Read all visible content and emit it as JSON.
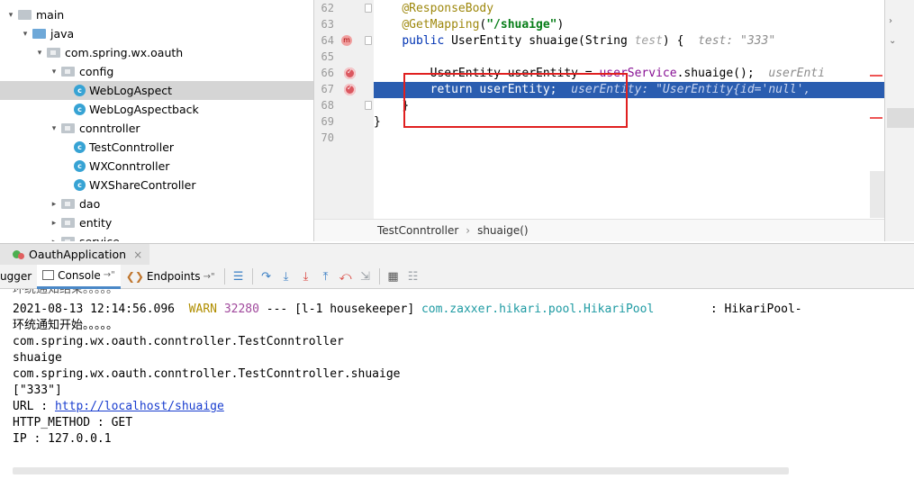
{
  "tree": {
    "items": [
      {
        "label": "main",
        "depth": 0,
        "arrow": "down",
        "icon": "folder"
      },
      {
        "label": "java",
        "depth": 1,
        "arrow": "down",
        "icon": "source-folder"
      },
      {
        "label": "com.spring.wx.oauth",
        "depth": 2,
        "arrow": "down",
        "icon": "package"
      },
      {
        "label": "config",
        "depth": 3,
        "arrow": "down",
        "icon": "package"
      },
      {
        "label": "WebLogAspect",
        "depth": 4,
        "arrow": "",
        "icon": "class",
        "selected": true
      },
      {
        "label": "WebLogAspectback",
        "depth": 4,
        "arrow": "",
        "icon": "class"
      },
      {
        "label": "conntroller",
        "depth": 3,
        "arrow": "down",
        "icon": "package"
      },
      {
        "label": "TestConntroller",
        "depth": 4,
        "arrow": "",
        "icon": "class"
      },
      {
        "label": "WXConntroller",
        "depth": 4,
        "arrow": "",
        "icon": "class"
      },
      {
        "label": "WXShareController",
        "depth": 4,
        "arrow": "",
        "icon": "class"
      },
      {
        "label": "dao",
        "depth": 3,
        "arrow": "right",
        "icon": "package"
      },
      {
        "label": "entity",
        "depth": 3,
        "arrow": "right",
        "icon": "package"
      },
      {
        "label": "service",
        "depth": 3,
        "arrow": "right",
        "icon": "package"
      }
    ]
  },
  "editor": {
    "line_numbers": [
      "62",
      "63",
      "64",
      "65",
      "66",
      "67",
      "68",
      "69",
      "70"
    ],
    "lines": {
      "l62": {
        "ann": "@ResponseBody"
      },
      "l63": {
        "ann": "@GetMapping",
        "open": "(",
        "str": "\"/shuaige\"",
        "close": ")"
      },
      "l64": {
        "kw": "public",
        "rest": " UserEntity shuaige(String ",
        "param": "test",
        "tail": ") {",
        "hint": "test: \"333\""
      },
      "l66": {
        "text1": "UserEntity userEntity = ",
        "call": "userService",
        "text2": ".shuaige();",
        "hint": "userEnti"
      },
      "l67": {
        "kw": "return",
        "rest": " userEntity;",
        "hint": "userEntity: \"UserEntity{id='null',"
      },
      "l68": {
        "text": "}"
      },
      "l69": {
        "text": "}"
      }
    },
    "breadcrumb": [
      "TestConntroller",
      "shuaige()"
    ]
  },
  "run": {
    "tab_label": "OauthApplication",
    "tabs": {
      "debugger": "ugger",
      "console": "Console",
      "endpoints": "Endpoints"
    },
    "pin": "→\""
  },
  "console": {
    "cut_line": "环统通知结束。。。。。",
    "log": {
      "timestamp": "2021-08-13 12:14:56.096",
      "level": "WARN",
      "pid": "32280",
      "sep": "---",
      "thread": "[l-1 housekeeper]",
      "logger": "com.zaxxer.hikari.pool.HikariPool",
      "msg": ": HikariPool-"
    },
    "lines": [
      "环统通知开始。。。。。",
      "com.spring.wx.oauth.conntroller.TestConntroller",
      "shuaige",
      "com.spring.wx.oauth.conntroller.TestConntroller.shuaige",
      "[\"333\"]"
    ],
    "url_label": "URL : ",
    "url": "http://localhost/shuaige",
    "method": "HTTP_METHOD : GET",
    "ip": "IP : 127.0.0.1"
  }
}
